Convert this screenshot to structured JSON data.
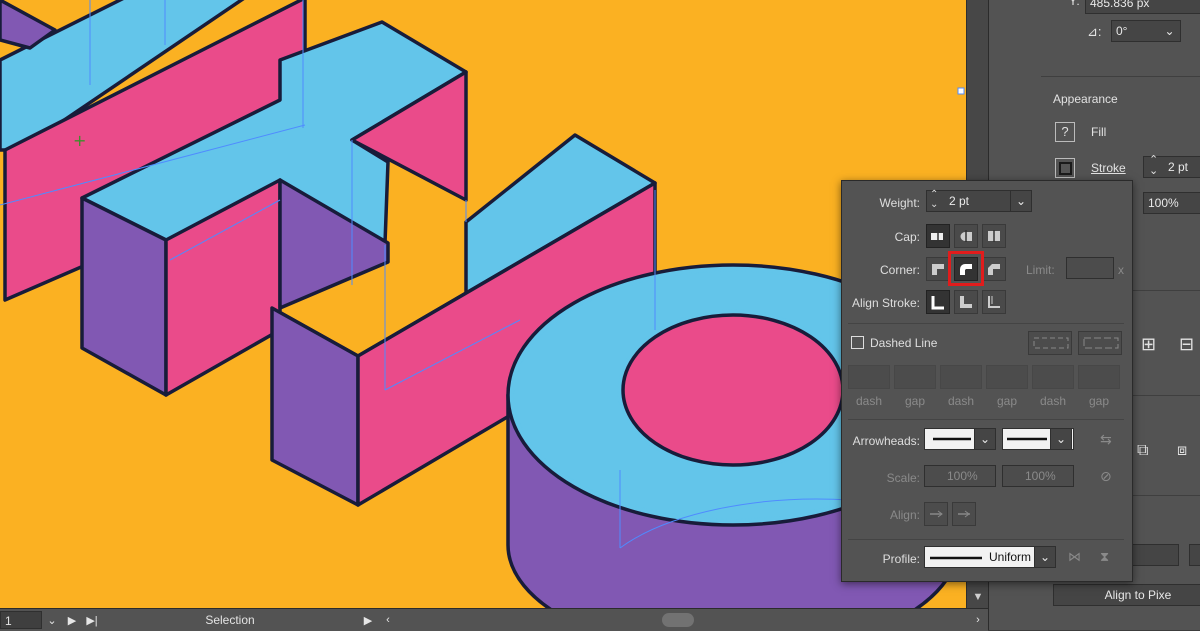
{
  "canvas": {
    "background": "#fbb122"
  },
  "artwork": {
    "colors": {
      "top": "#63c5ea",
      "front": "#ea4b8a",
      "side": "#8158b3",
      "outline": "#181c3a",
      "guide": "#4f8bff"
    }
  },
  "status_bar": {
    "zoom_value": "1",
    "tool_name": "Selection"
  },
  "right_panel": {
    "y_value": "485.836 px",
    "angle_value": "0°",
    "appearance_title": "Appearance",
    "fill_label": "Fill",
    "fill_icon": "?",
    "stroke_label": "Stroke",
    "stroke_weight": "2 pt",
    "opacity_value": "100%",
    "align_pixel_label": "Align to Pixe"
  },
  "stroke_panel": {
    "weight_label": "Weight:",
    "weight_value": "2 pt",
    "cap_label": "Cap:",
    "corner_label": "Corner:",
    "limit_label": "Limit:",
    "limit_suffix": "x",
    "align_stroke_label": "Align Stroke:",
    "dashed_line_label": "Dashed Line",
    "dash_gap_labels": [
      "dash",
      "gap",
      "dash",
      "gap",
      "dash",
      "gap"
    ],
    "arrowheads_label": "Arrowheads:",
    "scale_label": "Scale:",
    "scale_start": "100%",
    "scale_end": "100%",
    "align_label": "Align:",
    "profile_label": "Profile:",
    "profile_value": "Uniform",
    "highlight_color": "#e11c1c"
  }
}
